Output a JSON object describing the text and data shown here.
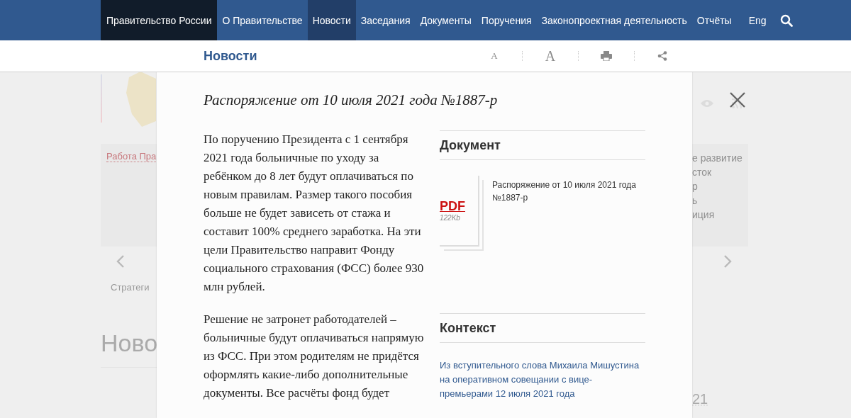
{
  "nav": {
    "brand": "Правительство России",
    "items": [
      {
        "label": "О Правительстве",
        "selected": false
      },
      {
        "label": "Новости",
        "selected": true
      },
      {
        "label": "Заседания",
        "selected": false
      },
      {
        "label": "Документы",
        "selected": false
      },
      {
        "label": "Поручения",
        "selected": false
      },
      {
        "label": "Законопроектная деятельность",
        "selected": false
      },
      {
        "label": "Отчёты",
        "selected": false
      }
    ],
    "language": "Eng"
  },
  "subheader": {
    "title": "Новости",
    "tools": [
      {
        "kind": "font-small",
        "label": "A"
      },
      {
        "kind": "font-large",
        "label": "A"
      },
      {
        "kind": "print"
      },
      {
        "kind": "share"
      }
    ]
  },
  "background": {
    "left": {
      "card_link": "Работа Пра",
      "caption": "Стратеги",
      "heading": "Ново"
    },
    "right": {
      "card_lines": [
        "е развитие",
        "сток",
        "р",
        "ь",
        "иция"
      ],
      "date_fragment": "21"
    }
  },
  "modal": {
    "title": "Распоряжение от 10 июля 2021 года №1887-р",
    "paragraphs": [
      "По поручению Президента с 1 сентября 2021 года больничные по уходу за ребёнком до 8 лет будут оплачиваться по новым правилам. Размер такого пособия больше не будет зависеть от стажа и составит 100% среднего заработка. На эти цели Правительство направит Фонду социального страхования (ФСС) более 930 млн рублей.",
      "Решение не затронет работодателей – больничные будут оплачиваться напрямую из ФСС. При этом родителям не придётся оформлять какие-либо дополнительные документы. Все расчёты фонд будет"
    ],
    "document": {
      "heading": "Документ",
      "file_type": "PDF",
      "file_size": "122Kb",
      "file_title": "Распоряжение от 10 июля 2021 года №1887-р"
    },
    "context": {
      "heading": "Контекст",
      "links": [
        "Из вступительного слова Михаила Мишустина на оперативном совещании с вице-премьерами 12 июля 2021 года"
      ]
    }
  }
}
